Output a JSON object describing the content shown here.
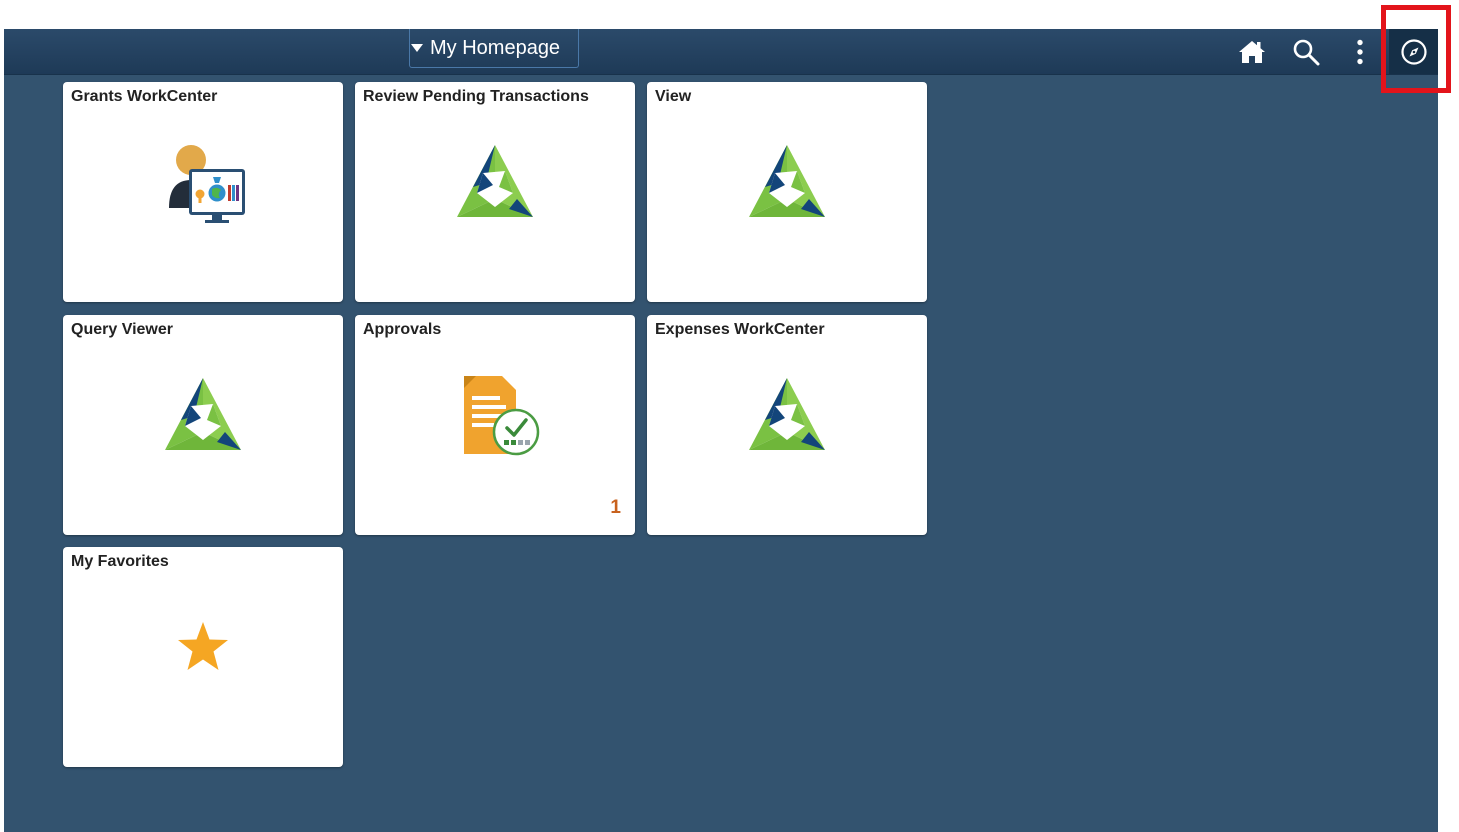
{
  "header": {
    "homepage_label": "My Homepage",
    "icons": {
      "home": "home-icon",
      "search": "search-icon",
      "actions": "more-vertical-icon",
      "navbar": "compass-icon"
    }
  },
  "tiles": [
    {
      "title": "Grants WorkCenter",
      "icon": "workcenter-person-icon"
    },
    {
      "title": "Review Pending Transactions",
      "icon": "logo-icon"
    },
    {
      "title": "View",
      "icon": "logo-icon"
    },
    {
      "title": "Query Viewer",
      "icon": "logo-icon"
    },
    {
      "title": "Approvals",
      "icon": "approval-document-icon",
      "count": "1"
    },
    {
      "title": "Expenses WorkCenter",
      "icon": "logo-icon"
    },
    {
      "title": "My Favorites",
      "icon": "star-icon"
    }
  ],
  "colors": {
    "background": "#33536f",
    "header": "#1e3a57",
    "highlight": "#e3141b",
    "logo_green": "#7ac143",
    "logo_navy": "#13457a",
    "star": "#f5a623",
    "count": "#c8621e"
  }
}
